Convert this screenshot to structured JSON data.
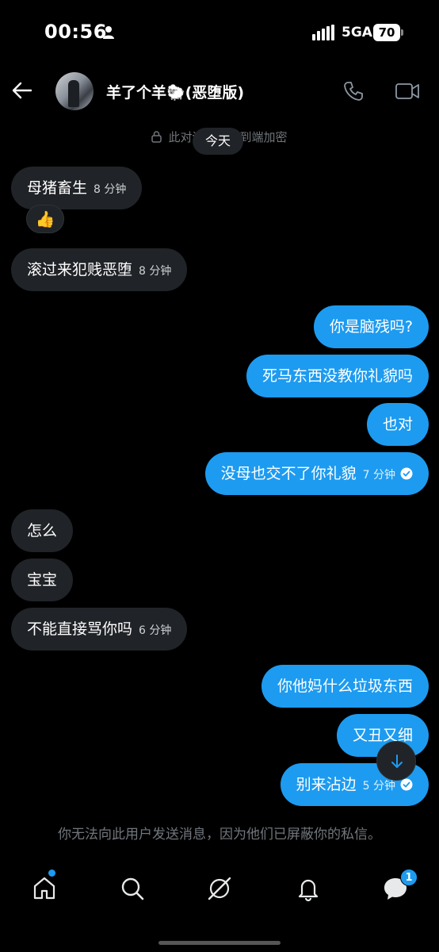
{
  "status_bar": {
    "time": "00:56",
    "network": "5GA",
    "battery": "70"
  },
  "header": {
    "contact_name": "羊了个羊🐑(恶堕版)",
    "back_icon": "back-arrow-icon",
    "call_icon": "phone-icon",
    "video_icon": "video-camera-icon"
  },
  "notice": {
    "encryption": "此对话现已端到端加密",
    "date": "今天"
  },
  "messages": [
    {
      "direction": "incoming",
      "text": "母猪畜生",
      "time": "8 分钟"
    },
    {
      "direction": "incoming",
      "text": "滚过来犯贱恶堕",
      "time": "8 分钟"
    },
    {
      "direction": "outgoing",
      "text": "你是脑残吗?",
      "time": ""
    },
    {
      "direction": "outgoing",
      "text": "死马东西没教你礼貌吗",
      "time": ""
    },
    {
      "direction": "outgoing",
      "text": "也对",
      "time": ""
    },
    {
      "direction": "outgoing",
      "text": "没母也交不了你礼貌",
      "time": "7 分钟"
    },
    {
      "direction": "incoming",
      "text": "怎么",
      "time": ""
    },
    {
      "direction": "incoming",
      "text": "宝宝",
      "time": ""
    },
    {
      "direction": "incoming",
      "text": "不能直接骂你吗",
      "time": "6 分钟"
    },
    {
      "direction": "outgoing",
      "text": "你他妈什么垃圾东西",
      "time": ""
    },
    {
      "direction": "outgoing",
      "text": "又丑又细",
      "time": ""
    },
    {
      "direction": "outgoing",
      "text": "别来沾边",
      "time": "5 分钟"
    }
  ],
  "reaction": "👍",
  "blocked_notice": "你无法向此用户发送消息，因为他们已屏蔽你的私信。",
  "bottom_nav": {
    "items": [
      "home-icon",
      "search-icon",
      "grok-icon",
      "notifications-icon",
      "messages-icon"
    ],
    "messages_badge": "1"
  },
  "colors": {
    "accent": "#1d9bf0",
    "incoming_bubble": "#202327",
    "background": "#000000",
    "muted_text": "#71767b"
  }
}
